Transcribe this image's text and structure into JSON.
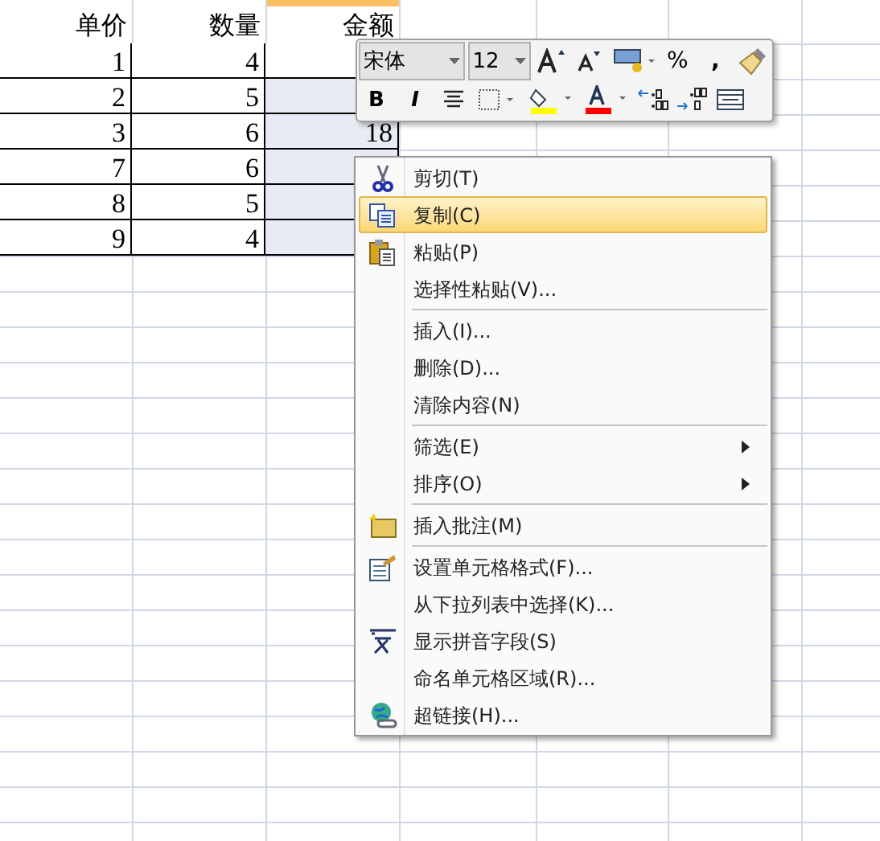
{
  "sheet": {
    "headers": [
      "单价",
      "数量",
      "金额"
    ],
    "rows": [
      {
        "cells": [
          "1",
          "4",
          ""
        ],
        "amount_selected": false
      },
      {
        "cells": [
          "2",
          "5",
          ""
        ],
        "amount_selected": true
      },
      {
        "cells": [
          "3",
          "6",
          "18"
        ],
        "amount_selected": true
      },
      {
        "cells": [
          "7",
          "6",
          ""
        ],
        "amount_selected": true
      },
      {
        "cells": [
          "8",
          "5",
          ""
        ],
        "amount_selected": true
      },
      {
        "cells": [
          "9",
          "4",
          ""
        ],
        "amount_selected": true
      }
    ]
  },
  "mini_toolbar": {
    "font": "宋体",
    "size": "12",
    "bold": "B",
    "italic": "I",
    "percent": "%",
    "comma": ","
  },
  "context_menu": [
    {
      "kind": "item",
      "label": "剪切(T)",
      "selected": false
    },
    {
      "kind": "item",
      "label": "复制(C)",
      "selected": true
    },
    {
      "kind": "item",
      "label": "粘贴(P)",
      "selected": false
    },
    {
      "kind": "item",
      "label": "选择性粘贴(V)...",
      "selected": false
    },
    {
      "kind": "separator"
    },
    {
      "kind": "item",
      "label": "插入(I)...",
      "selected": false
    },
    {
      "kind": "item",
      "label": "删除(D)...",
      "selected": false
    },
    {
      "kind": "item",
      "label": "清除内容(N)",
      "selected": false
    },
    {
      "kind": "separator"
    },
    {
      "kind": "submenu",
      "label": "筛选(E)",
      "selected": false
    },
    {
      "kind": "submenu",
      "label": "排序(O)",
      "selected": false
    },
    {
      "kind": "separator"
    },
    {
      "kind": "item",
      "label": "插入批注(M)",
      "selected": false
    },
    {
      "kind": "separator"
    },
    {
      "kind": "item",
      "label": "设置单元格格式(F)...",
      "selected": false
    },
    {
      "kind": "item",
      "label": "从下拉列表中选择(K)...",
      "selected": false
    },
    {
      "kind": "item",
      "label": "显示拼音字段(S)",
      "selected": false
    },
    {
      "kind": "item",
      "label": "命名单元格区域(R)...",
      "selected": false
    },
    {
      "kind": "item",
      "label": "超链接(H)...",
      "selected": false
    }
  ]
}
